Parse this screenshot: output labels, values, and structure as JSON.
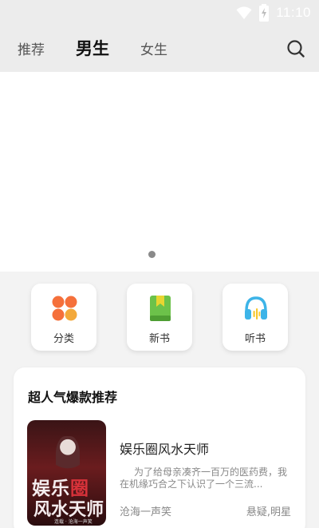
{
  "status_bar": {
    "time": "11:10"
  },
  "tabs": [
    {
      "label": "推荐",
      "active": false
    },
    {
      "label": "男生",
      "active": true
    },
    {
      "label": "女生",
      "active": false
    }
  ],
  "quick_entries": [
    {
      "label": "分类",
      "icon": "category-icon"
    },
    {
      "label": "新书",
      "icon": "book-icon"
    },
    {
      "label": "听书",
      "icon": "headphones-icon"
    }
  ],
  "recommend": {
    "title": "超人气爆款推荐",
    "book": {
      "cover_title_line1_a": "娱乐",
      "cover_title_line1_b": "圈",
      "cover_title_line2": "风水天师",
      "cover_caption": "连载 · 沧海一声笑",
      "title": "娱乐圈风水天师",
      "description": "为了给母亲凑齐一百万的医药费，我在机缘巧合之下认识了一个三流...",
      "author": "沧海一声笑",
      "tags": "悬疑,明星"
    }
  },
  "colors": {
    "category_orange": "#f5703b",
    "category_amber": "#f3a93b",
    "newbook_green": "#6cc24a",
    "newbook_yellow": "#e8d531",
    "audiobook_blue": "#3db4e8",
    "audiobook_yellow": "#f7c82d"
  }
}
